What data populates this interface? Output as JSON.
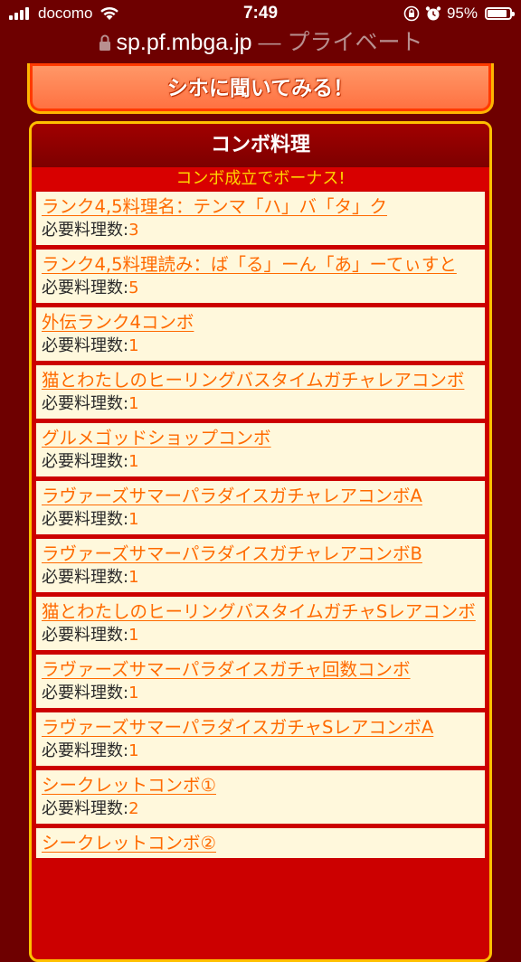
{
  "status_bar": {
    "carrier": "docomo",
    "time": "7:49",
    "battery_percent_text": "95%",
    "battery_level": 0.95
  },
  "url_bar": {
    "domain": "sp.pf.mbga.jp",
    "suffix": " — プライベート"
  },
  "ask_button": {
    "label": "シホに聞いてみる！"
  },
  "combo_panel": {
    "title": "コンボ料理",
    "subtitle": "コンボ成立でボーナス!",
    "req_label": "必要料理数:",
    "items": [
      {
        "name": "ランク4,5料理名：テンマ「ハ」バ「タ」ク",
        "count": "3"
      },
      {
        "name": "ランク4,5料理読み：ば「る」ーん「あ」ーてぃすと",
        "count": "5"
      },
      {
        "name": "外伝ランク4コンボ",
        "count": "1"
      },
      {
        "name": "猫とわたしのヒーリングバスタイムガチャレアコンボ",
        "count": "1"
      },
      {
        "name": "グルメゴッドショップコンボ",
        "count": "1"
      },
      {
        "name": "ラヴァーズサマーパラダイスガチャレアコンボA",
        "count": "1"
      },
      {
        "name": "ラヴァーズサマーパラダイスガチャレアコンボB",
        "count": "1"
      },
      {
        "name": "猫とわたしのヒーリングバスタイムガチャSレアコンボ",
        "count": "1"
      },
      {
        "name": "ラヴァーズサマーパラダイスガチャ回数コンボ",
        "count": "1"
      },
      {
        "name": "ラヴァーズサマーパラダイスガチャSレアコンボA",
        "count": "1"
      },
      {
        "name": "シークレットコンボ①",
        "count": "2"
      },
      {
        "name": "シークレットコンボ②",
        "count": ""
      }
    ]
  },
  "colors": {
    "page_bg": "#6e0000",
    "panel_border": "#ffc000",
    "panel_header": "#8d0000",
    "subheader_text": "#ffd400",
    "item_bg": "#fff8dc",
    "link": "#ff6a00"
  },
  "icons": [
    "signal-icon",
    "wifi-icon",
    "orientation-lock-icon",
    "alarm-icon",
    "battery-icon",
    "lock-icon"
  ]
}
